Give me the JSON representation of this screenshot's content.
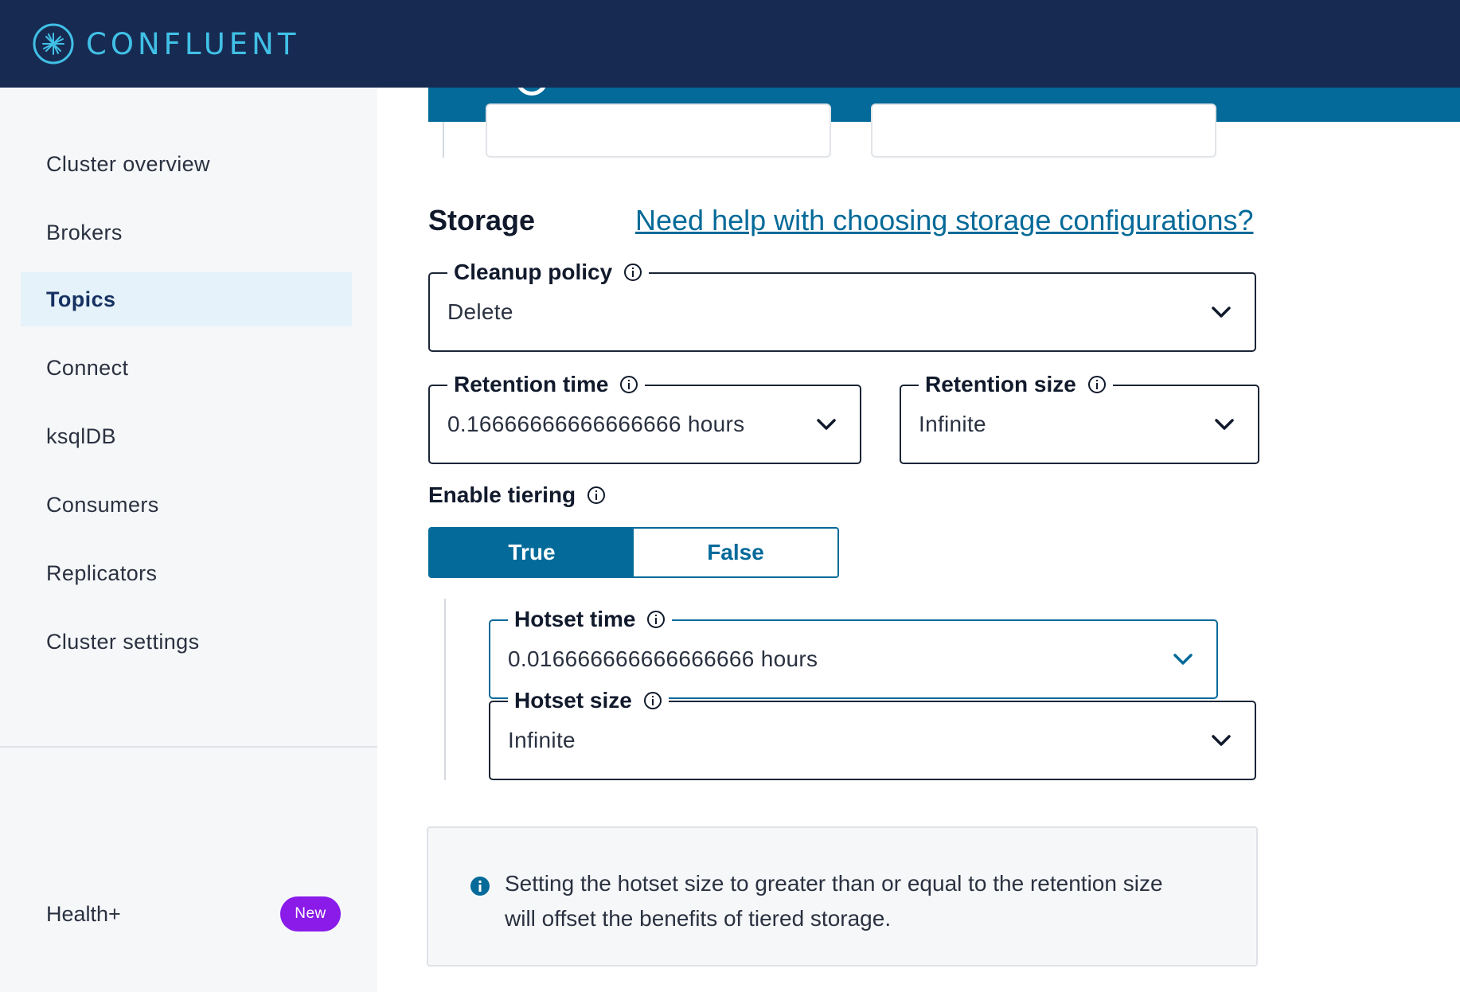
{
  "header": {
    "brand": "CONFLUENT",
    "colors": {
      "background": "#172b52",
      "brand_text": "#41c0e6"
    }
  },
  "sidebar": {
    "items": [
      {
        "label": "Cluster overview",
        "active": false
      },
      {
        "label": "Brokers",
        "active": false
      },
      {
        "label": "Topics",
        "active": true
      },
      {
        "label": "Connect",
        "active": false
      },
      {
        "label": "ksqlDB",
        "active": false
      },
      {
        "label": "Consumers",
        "active": false
      },
      {
        "label": "Replicators",
        "active": false
      },
      {
        "label": "Cluster settings",
        "active": false
      }
    ],
    "health": {
      "label": "Health+",
      "badge": "New"
    }
  },
  "storage": {
    "title": "Storage",
    "help_link": "Need help with choosing storage configurations?",
    "cleanup_policy": {
      "label": "Cleanup policy",
      "value": "Delete"
    },
    "retention_time": {
      "label": "Retention time",
      "value": "0.16666666666666666 hours"
    },
    "retention_size": {
      "label": "Retention size",
      "value": "Infinite"
    },
    "enable_tiering": {
      "label": "Enable tiering",
      "options": [
        "True",
        "False"
      ],
      "selected": "True"
    },
    "hotset_time": {
      "label": "Hotset time",
      "value": "0.016666666666666666 hours"
    },
    "hotset_size": {
      "label": "Hotset size",
      "value": "Infinite"
    },
    "note": "Setting the hotset size to greater than or equal to the retention size will offset the benefits of tiered storage."
  },
  "theme": {
    "accent": "#046a99",
    "badge": "#8a1be8"
  }
}
